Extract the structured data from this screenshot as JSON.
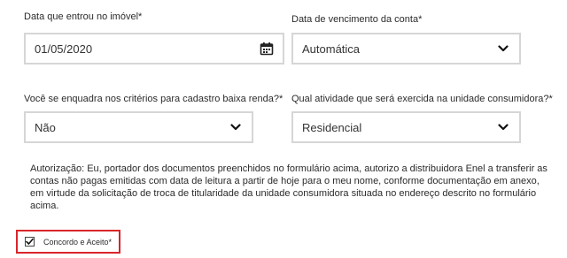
{
  "form": {
    "move_in_date": {
      "label": "Data que entrou no imóvel*",
      "value": "01/05/2020"
    },
    "due_date": {
      "label": "Data de vencimento da conta*",
      "value": "Automática"
    },
    "low_income": {
      "label": "Você se enquadra nos critérios para cadastro baixa renda?*",
      "value": "Não"
    },
    "activity": {
      "label": "Qual atividade que será exercida na unidade consumidora?*",
      "value": "Residencial"
    },
    "authorization_text": "Autorização: Eu, portador dos documentos preenchidos no formulário acima, autorizo a distribuidora Enel a transferir as contas não pagas emitidas com data de leitura a partir de hoje para o meu nome, conforme documentação em anexo, em virtude da solicitação de troca de titularidade da unidade consumidora situada no endereço descrito no formulário acima.",
    "consent": {
      "label": "Concordo e Aceito*",
      "checked": true
    }
  },
  "icons": {
    "calendar": "calendar-icon",
    "chevron": "chevron-down-icon",
    "check": "checkmark-icon"
  },
  "colors": {
    "field_border": "#d6d6d6",
    "highlight_border": "#d9262b"
  }
}
